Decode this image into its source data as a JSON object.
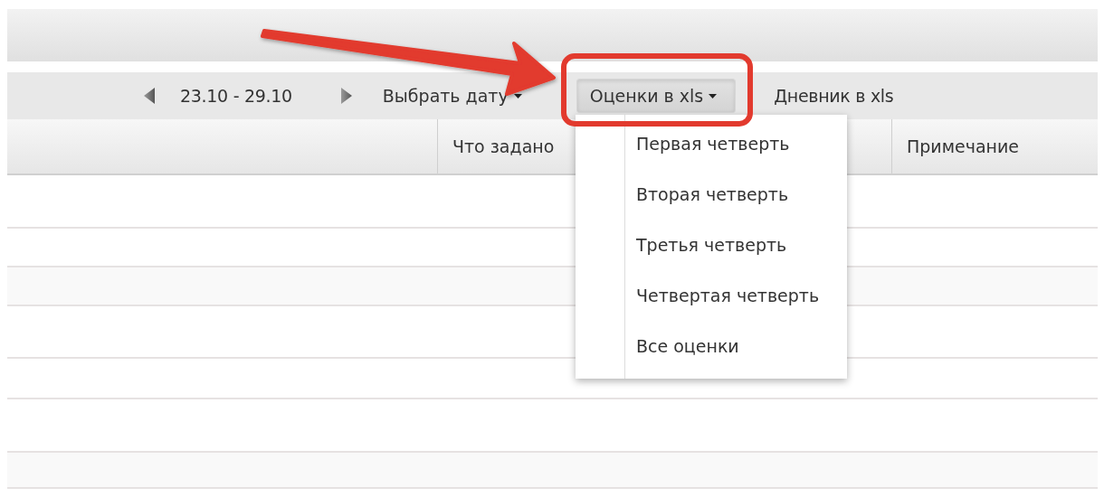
{
  "toolbar": {
    "period": "23.10 - 29.10",
    "date_picker": "Выбрать дату",
    "grades_export": {
      "label": "Оценки в xls",
      "expanded": true
    },
    "diary_export": "Дневник в xls"
  },
  "table": {
    "columns": [
      "Что задано",
      "Примечание"
    ]
  },
  "grades_menu": {
    "items": [
      {
        "label": "Первая четверть"
      },
      {
        "label": "Вторая четверть"
      },
      {
        "label": "Третья четверть"
      },
      {
        "label": "Четвертая четверть"
      },
      {
        "label": "Все оценки"
      }
    ]
  }
}
